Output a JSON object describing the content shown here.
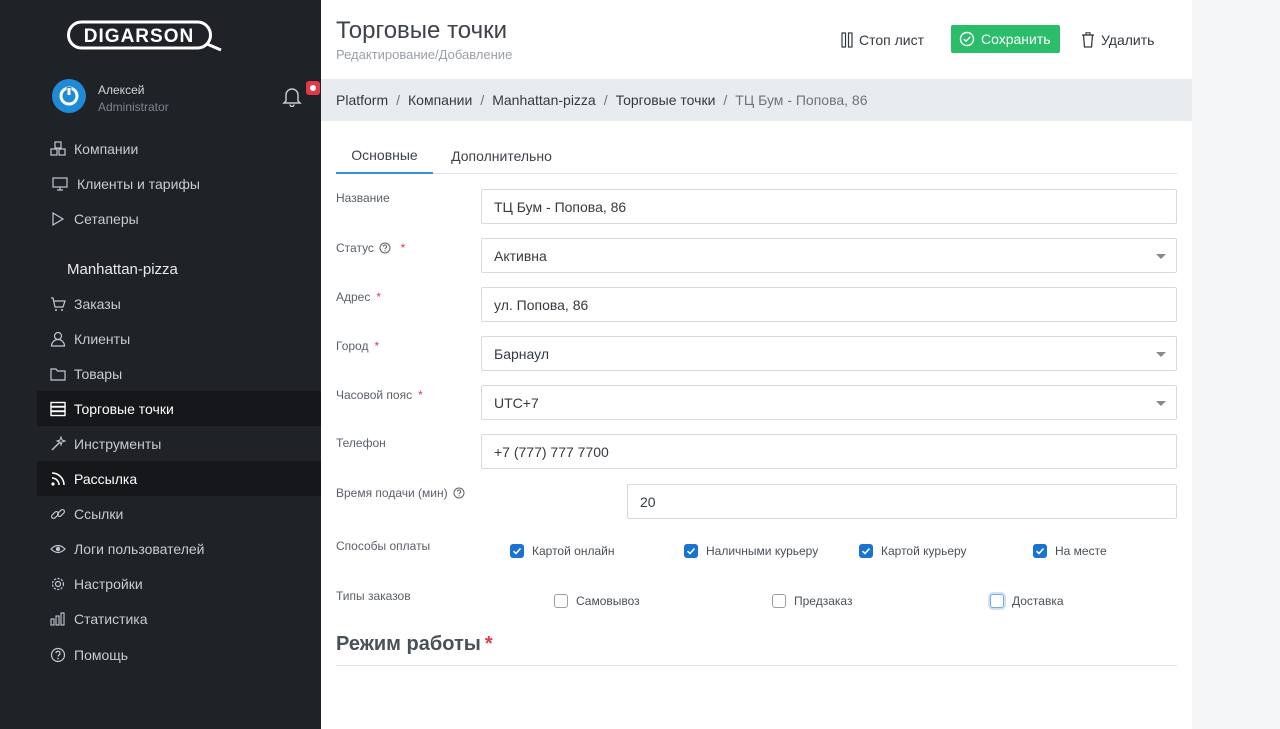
{
  "brand": {
    "logo_text": "DIGARSON"
  },
  "user": {
    "name": "Алексей",
    "role": "Administrator"
  },
  "sidebar": {
    "top_items": [
      {
        "label": "Компании",
        "icon": "companies-icon"
      },
      {
        "label": "Клиенты и тарифы",
        "icon": "monitor-icon"
      },
      {
        "label": "Сетаперы",
        "icon": "play-icon"
      }
    ],
    "section_title": "Manhattan-pizza",
    "items": [
      {
        "label": "Заказы",
        "icon": "cart-icon"
      },
      {
        "label": "Клиенты",
        "icon": "user-icon"
      },
      {
        "label": "Товары",
        "icon": "folder-icon"
      },
      {
        "label": "Торговые точки",
        "icon": "server-icon",
        "active": true
      },
      {
        "label": "Инструменты",
        "icon": "wand-icon"
      },
      {
        "label": "Рассылка",
        "icon": "rss-icon",
        "active": true
      },
      {
        "label": "Ссылки",
        "icon": "link-icon"
      },
      {
        "label": "Логи пользователей",
        "icon": "eye-icon"
      },
      {
        "label": "Настройки",
        "icon": "gear-icon"
      },
      {
        "label": "Статистика",
        "icon": "stats-icon"
      },
      {
        "label": "Помощь",
        "icon": "help-icon"
      }
    ]
  },
  "header": {
    "title": "Торговые точки",
    "subtitle": "Редактирование/Добавление",
    "stop_label": "Стоп лист",
    "save_label": "Сохранить",
    "delete_label": "Удалить"
  },
  "breadcrumb": [
    "Platform",
    "Компании",
    "Manhattan-pizza",
    "Торговые точки",
    "ТЦ Бум - Попова, 86"
  ],
  "tabs": [
    {
      "label": "Основные",
      "active": true
    },
    {
      "label": "Дополнительно",
      "active": false
    }
  ],
  "form": {
    "name": {
      "label": "Название",
      "value": "ТЦ Бум - Попова, 86"
    },
    "status": {
      "label": "Статус",
      "value": "Активна",
      "required": true
    },
    "address": {
      "label": "Адрес",
      "value": "ул. Попова, 86",
      "required": true
    },
    "city": {
      "label": "Город",
      "value": "Барнаул",
      "required": true
    },
    "timezone": {
      "label": "Часовой пояс",
      "value": "UTC+7",
      "required": true
    },
    "phone": {
      "label": "Телефон",
      "value": "+7 (777) 777 7700"
    },
    "delivery_time": {
      "label": "Время подачи (мин)",
      "value": "20"
    },
    "payment": {
      "label": "Способы оплаты",
      "options": [
        {
          "label": "Картой онлайн",
          "checked": true
        },
        {
          "label": "Наличными курьеру",
          "checked": true
        },
        {
          "label": "Картой курьеру",
          "checked": true
        },
        {
          "label": "На месте",
          "checked": true
        }
      ]
    },
    "order_types": {
      "label": "Типы заказов",
      "options": [
        {
          "label": "Самовывоз",
          "checked": false
        },
        {
          "label": "Предзаказ",
          "checked": false
        },
        {
          "label": "Доставка",
          "checked": false
        }
      ]
    },
    "schedule_title": "Режим работы",
    "required_mark": "*"
  },
  "colors": {
    "sidebar_bg": "#1f2227",
    "accent_green": "#2bbd6a",
    "accent_blue": "#1b73d1",
    "required": "#e03a48"
  }
}
